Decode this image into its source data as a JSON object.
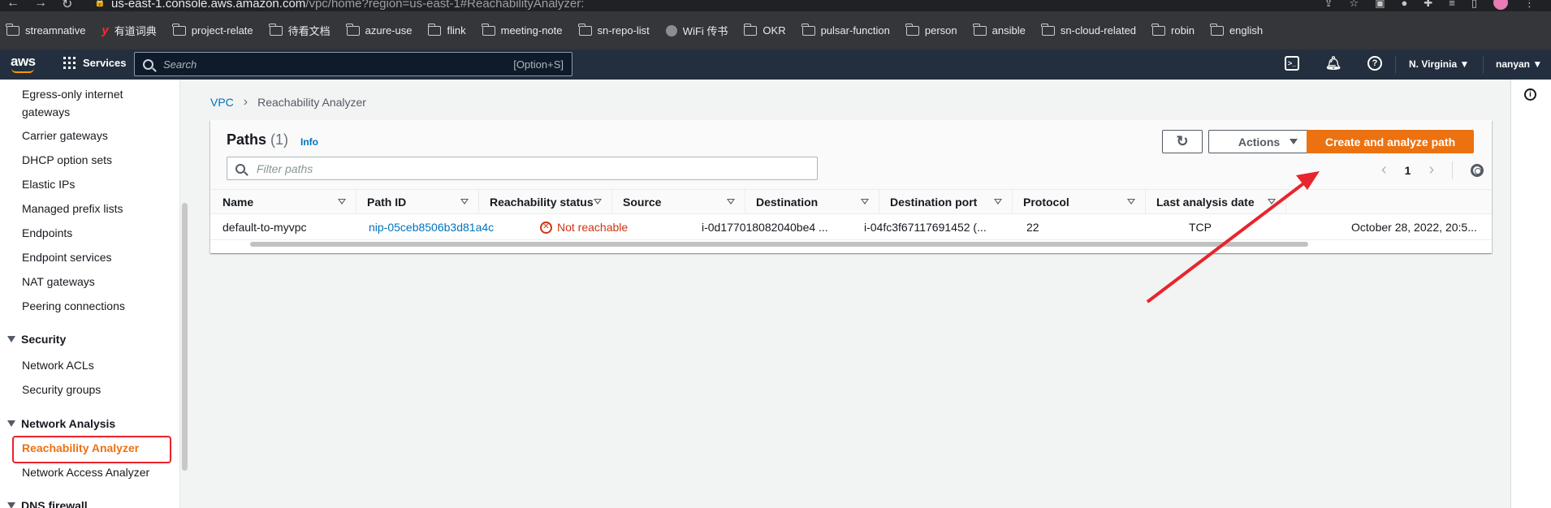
{
  "browser": {
    "url_host": "us-east-1.console.aws.amazon.com",
    "url_path": "/vpc/home?region=us-east-1#ReachabilityAnalyzer:",
    "bookmarks": [
      {
        "label": "streamnative",
        "icon": "folder-icon"
      },
      {
        "label": "有道词典",
        "icon": "youdao-icon"
      },
      {
        "label": "project-relate",
        "icon": "folder-icon"
      },
      {
        "label": "待看文档",
        "icon": "folder-icon"
      },
      {
        "label": "azure-use",
        "icon": "folder-icon"
      },
      {
        "label": "flink",
        "icon": "folder-icon"
      },
      {
        "label": "meeting-note",
        "icon": "folder-icon"
      },
      {
        "label": "sn-repo-list",
        "icon": "folder-icon"
      },
      {
        "label": "WiFi 传书",
        "icon": "globe-icon"
      },
      {
        "label": "OKR",
        "icon": "folder-icon"
      },
      {
        "label": "pulsar-function",
        "icon": "folder-icon"
      },
      {
        "label": "person",
        "icon": "folder-icon"
      },
      {
        "label": "ansible",
        "icon": "folder-icon"
      },
      {
        "label": "sn-cloud-related",
        "icon": "folder-icon"
      },
      {
        "label": "robin",
        "icon": "folder-icon"
      },
      {
        "label": "english",
        "icon": "folder-icon"
      }
    ]
  },
  "aws_header": {
    "logo": "aws",
    "services_label": "Services",
    "search_placeholder": "Search",
    "search_shortcut": "[Option+S]",
    "region": "N. Virginia ▼",
    "user": "nanyan ▼"
  },
  "sidebar": {
    "items": [
      {
        "label": "Egress-only internet",
        "label2": "gateways"
      },
      {
        "label": "Carrier gateways"
      },
      {
        "label": "DHCP option sets"
      },
      {
        "label": "Elastic IPs"
      },
      {
        "label": "Managed prefix lists"
      },
      {
        "label": "Endpoints"
      },
      {
        "label": "Endpoint services"
      },
      {
        "label": "NAT gateways"
      },
      {
        "label": "Peering connections"
      }
    ],
    "security_section": "Security",
    "security_items": [
      "Network ACLs",
      "Security groups"
    ],
    "analysis_section": "Network Analysis",
    "analysis_items": [
      "Reachability Analyzer",
      "Network Access Analyzer"
    ],
    "next_section": "DNS firewall"
  },
  "breadcrumb": {
    "root": "VPC",
    "current": "Reachability Analyzer"
  },
  "panel": {
    "title": "Paths",
    "count": "(1)",
    "info": "Info",
    "filter_placeholder": "Filter paths",
    "actions_label": "Actions",
    "primary_label": "Create and analyze path",
    "page": "1"
  },
  "table": {
    "columns": [
      "Name",
      "Path ID",
      "Reachability status",
      "Source",
      "Destination",
      "Destination port",
      "Protocol",
      "Last analysis date"
    ],
    "rows": [
      {
        "name": "default-to-myvpc",
        "path_id": "nip-05ceb8506b3d81a4c",
        "status": "Not reachable",
        "source": "i-0d177018082040be4 ...",
        "destination": "i-04fc3f67117691452 (...",
        "port": "22",
        "protocol": "TCP",
        "last_analysis": "October 28, 2022, 20:5..."
      }
    ]
  },
  "colors": {
    "primary_orange": "#ec7211",
    "link_blue": "#0073bb",
    "error_red": "#d13212",
    "annotation_red": "#e8242c",
    "header_navy": "#232f3e"
  }
}
